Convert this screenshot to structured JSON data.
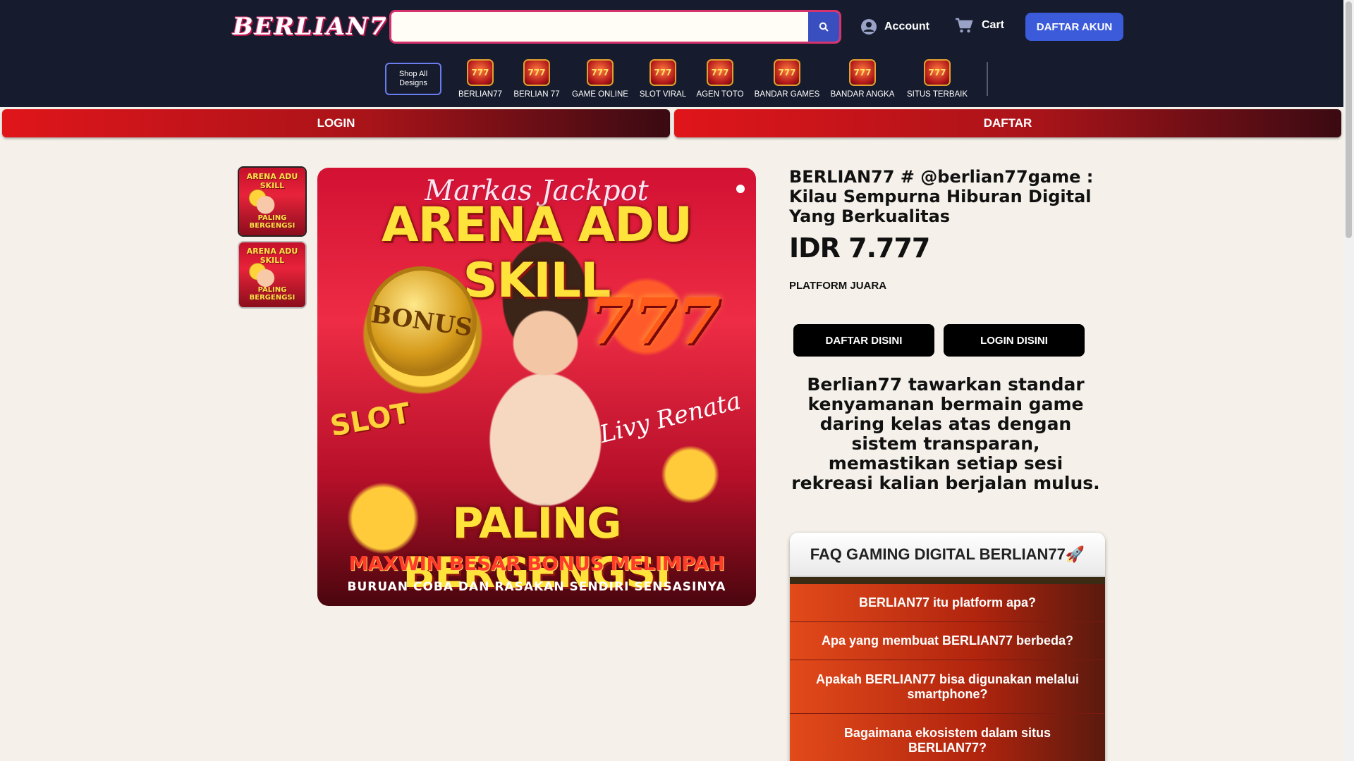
{
  "header": {
    "logo": "BERLIAN77",
    "search": {
      "value": "",
      "placeholder": ""
    },
    "account_label": "Account",
    "cart_label": "Cart",
    "register_button": "DAFTAR AKUN",
    "shop_all": "Shop All Designs",
    "categories": [
      {
        "label": "BERLIAN77",
        "icon": "777-icon"
      },
      {
        "label": "BERLIAN 77",
        "icon": "777-icon"
      },
      {
        "label": "GAME ONLINE",
        "icon": "777-icon"
      },
      {
        "label": "SLOT VIRAL",
        "icon": "777-icon"
      },
      {
        "label": "AGEN TOTO",
        "icon": "777-icon"
      },
      {
        "label": "BANDAR GAMES",
        "icon": "777-icon"
      },
      {
        "label": "BANDAR ANGKA",
        "icon": "777-icon"
      },
      {
        "label": "SITUS TERBAIK",
        "icon": "777-icon"
      }
    ]
  },
  "bars": {
    "login": "LOGIN",
    "daftar": "DAFTAR"
  },
  "banner": {
    "script_text": "Markas Jackpot",
    "title": "ARENA ADU SKILL",
    "coin_text": "BONUS",
    "slot_text": "SLOT",
    "sign_text": "Livy Renata",
    "main_title": "PALING BERGENGSI",
    "subtitle": "MAXWIN BESAR BONUS MELIMPAH",
    "tagline": "BURUAN COBA DAN RASAKAN SENDIRI SENSASINYA"
  },
  "thumbs": [
    {
      "top": "ARENA ADU SKILL",
      "bottom": "PALING BERGENGSI"
    },
    {
      "top": "ARENA ADU SKILL",
      "bottom": "PALING BERGENGSI"
    }
  ],
  "product": {
    "title": "BERLIAN77 # @berlian77game : Kilau Sempurna Hiburan Digital Yang Berkualitas",
    "price": "IDR 7.777",
    "platform": "PLATFORM JUARA",
    "cta_daftar": "DAFTAR DISINI",
    "cta_login": "LOGIN DISINI",
    "description": "Berlian77 tawarkan standar kenyamanan bermain game daring kelas atas dengan sistem transparan, memastikan setiap sesi rekreasi kalian berjalan mulus."
  },
  "faq": {
    "title": "FAQ GAMING DIGITAL BERLIAN77🚀",
    "items": [
      "BERLIAN77 itu platform apa?",
      "Apa yang membuat BERLIAN77 berbeda?",
      "Apakah BERLIAN77 bisa digunakan melalui smartphone?",
      "Bagaimana ekosistem dalam situs BERLIAN77?"
    ]
  },
  "colors": {
    "header_bg": "#161c2d",
    "accent_blue": "#3b5bdb",
    "bar_red": "#e0151a",
    "search_border": "#d6336c",
    "page_bg": "#f5f1ea"
  }
}
